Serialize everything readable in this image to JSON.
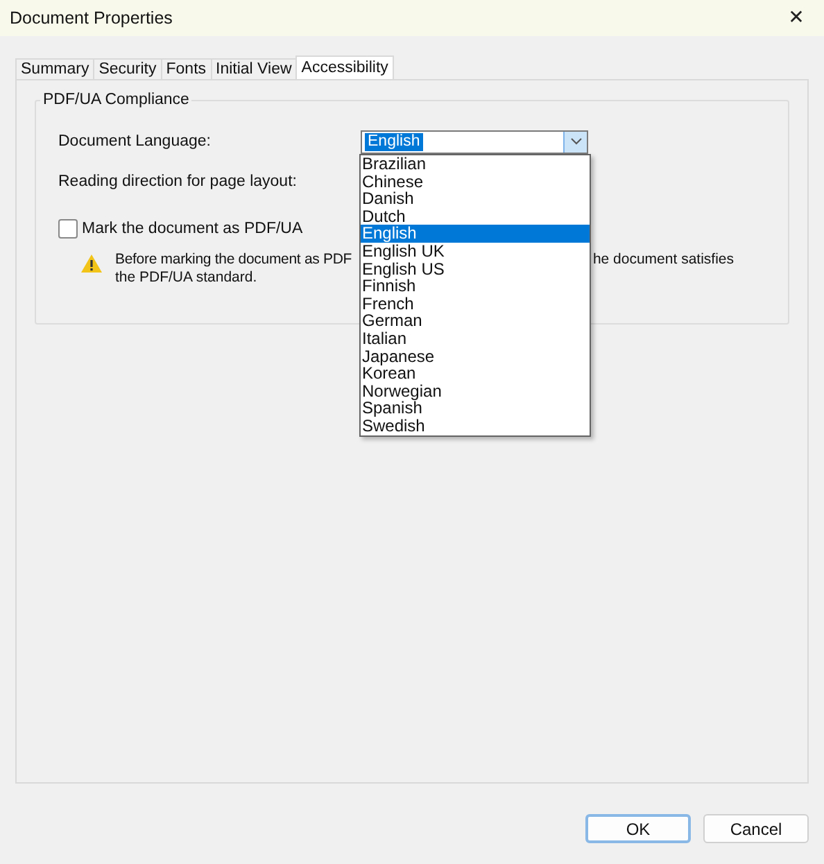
{
  "window": {
    "title": "Document Properties",
    "close": "✕"
  },
  "tabs": [
    {
      "label": "Summary",
      "selected": false
    },
    {
      "label": "Security",
      "selected": false
    },
    {
      "label": "Fonts",
      "selected": false
    },
    {
      "label": "Initial View",
      "selected": false
    },
    {
      "label": "Accessibility",
      "selected": true
    }
  ],
  "group": {
    "title": "PDF/UA Compliance",
    "language_label": "Document Language:",
    "language_value": "English",
    "reading_direction_label": "Reading direction for page layout:",
    "mark_checkbox": {
      "label": "Mark the document as PDF/UA",
      "checked": false
    },
    "warning": {
      "line_1_left": "Before marking the document as PDF",
      "line_1_right": "he document satisfies",
      "line_2": "the PDF/UA standard."
    }
  },
  "language_list": [
    {
      "label": "Brazilian",
      "selected": false
    },
    {
      "label": "Chinese",
      "selected": false
    },
    {
      "label": "Danish",
      "selected": false
    },
    {
      "label": "Dutch",
      "selected": false
    },
    {
      "label": "English",
      "selected": true
    },
    {
      "label": "English UK",
      "selected": false
    },
    {
      "label": "English US",
      "selected": false
    },
    {
      "label": "Finnish",
      "selected": false
    },
    {
      "label": "French",
      "selected": false
    },
    {
      "label": "German",
      "selected": false
    },
    {
      "label": "Italian",
      "selected": false
    },
    {
      "label": "Japanese",
      "selected": false
    },
    {
      "label": "Korean",
      "selected": false
    },
    {
      "label": "Norwegian",
      "selected": false
    },
    {
      "label": "Spanish",
      "selected": false
    },
    {
      "label": "Swedish",
      "selected": false
    }
  ],
  "buttons": [
    "OK",
    "Cancel"
  ]
}
